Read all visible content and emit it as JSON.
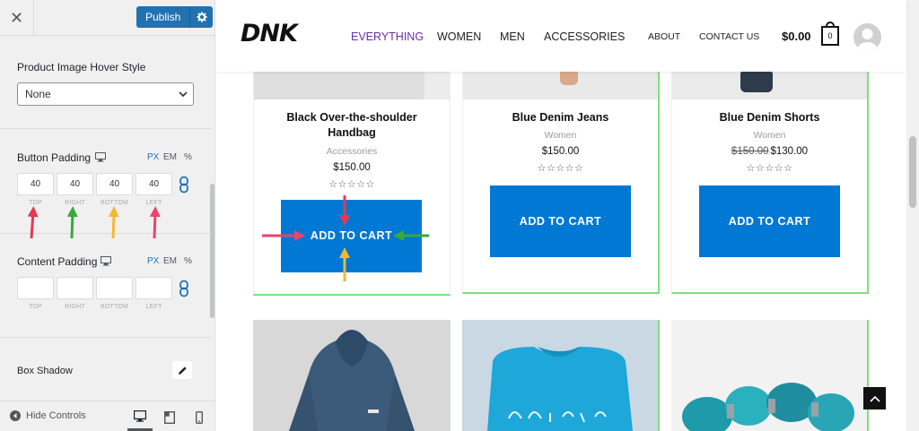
{
  "customizer": {
    "close_label": "✕",
    "publish_label": "Publish",
    "hover_style": {
      "label": "Product Image Hover Style",
      "value": "None"
    },
    "button_padding": {
      "label": "Button Padding",
      "units": [
        "PX",
        "EM",
        "%"
      ],
      "active_unit": "PX",
      "fields": [
        {
          "value": "40",
          "caption": "TOP"
        },
        {
          "value": "40",
          "caption": "RIGHT"
        },
        {
          "value": "40",
          "caption": "BOTTOM"
        },
        {
          "value": "40",
          "caption": "LEFT"
        }
      ]
    },
    "content_padding": {
      "label": "Content Padding",
      "units": [
        "PX",
        "EM",
        "%"
      ],
      "active_unit": "PX",
      "fields": [
        {
          "value": "",
          "caption": "TOP"
        },
        {
          "value": "",
          "caption": "RIGHT"
        },
        {
          "value": "",
          "caption": "BOTTOM"
        },
        {
          "value": "",
          "caption": "LEFT"
        }
      ]
    },
    "box_shadow_label": "Box Shadow",
    "hide_controls_label": "Hide Controls",
    "accent_color": "#2271b1"
  },
  "site": {
    "logo": "DNK",
    "nav": [
      "EVERYTHING",
      "WOMEN",
      "MEN",
      "ACCESSORIES"
    ],
    "nav_active": "EVERYTHING",
    "nav_secondary": [
      "ABOUT",
      "CONTACT US"
    ],
    "cart_total": "$0.00",
    "cart_count": "0",
    "active_color": "#6b2fa3"
  },
  "products": [
    {
      "title": "Black Over-the-shoulder Handbag",
      "category": "Accessories",
      "price": "$150.00",
      "old_price": "",
      "rating_stars": "☆☆☆☆☆",
      "button": "ADD TO CART"
    },
    {
      "title": "Blue Denim Jeans",
      "category": "Women",
      "price": "$150.00",
      "old_price": "",
      "rating_stars": "☆☆☆☆☆",
      "button": "ADD TO CART"
    },
    {
      "title": "Blue Denim Shorts",
      "category": "Women",
      "price": "$130.00",
      "old_price": "$150.00",
      "rating_stars": "☆☆☆☆☆",
      "button": "ADD TO CART"
    }
  ],
  "button_color": "#0078d4",
  "annotation_colors": {
    "top": "#e8384f",
    "right": "#3aa935",
    "bottom": "#f5b731",
    "left": "#e8456b"
  }
}
